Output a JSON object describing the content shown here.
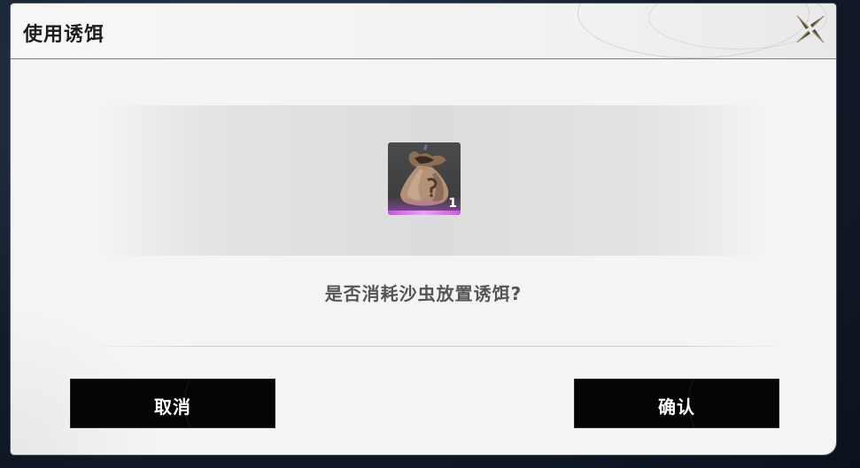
{
  "dialog": {
    "title": "使用诱饵",
    "close_icon": "close-x-icon",
    "item": {
      "icon": "bait-bag-icon",
      "count": "1",
      "rarity_color": "#c45bd8"
    },
    "question": "是否消耗沙虫放置诱饵?",
    "cancel_label": "取消",
    "confirm_label": "确认"
  },
  "colors": {
    "dialog_bg": "#f4f4f4",
    "button_bg": "#050505",
    "title_text": "#1d1d1d",
    "question_text": "#555555"
  }
}
